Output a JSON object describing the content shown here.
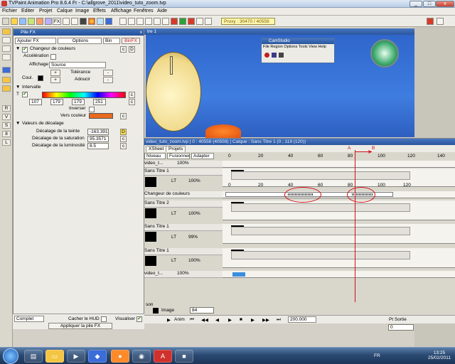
{
  "window": {
    "title": "TVPaint Animation Pro 8.6.4 Fr - C:\\allgrove_2011\\video_tuto_zoom.tvp",
    "controls": {
      "min": "_",
      "max": "□",
      "close": "x"
    }
  },
  "menu": [
    "Fichier",
    "Editer",
    "Projet",
    "Calque",
    "Image",
    "Effets",
    "Affichage",
    "Fenêtres",
    "Aide"
  ],
  "toolbar": {
    "fx_label": "FX",
    "proxy": "Proxy : 30470 / 40559"
  },
  "left_tools": [
    "R",
    "V",
    "S",
    "8",
    "L"
  ],
  "pile_fx": {
    "title": "Pile FX",
    "close": "x",
    "header_buttons": {
      "add": "Ajouter FX",
      "options": "Options",
      "bin": "Bin",
      "binfx": "BinFX"
    },
    "effect_name": "Changeur de couleurs",
    "acceleration_label": "Accélération",
    "affichage_label": "Affichage",
    "affichage_value": "Source",
    "tolerance_label": "Tolérance",
    "adoucir_label": "Adoucir",
    "coul_label": "Coul.",
    "plus": "+",
    "minus": "-",
    "intervalle_label": "Intervalle",
    "t_label": "T",
    "range_values": [
      "107",
      "179",
      "179",
      "251"
    ],
    "inverser_label": "Inverser",
    "vers_couleur_label": "Vers couleur",
    "vers_couleur_color": "#e86a1e",
    "decalage_title": "Valeurs de décalage",
    "decalage": [
      {
        "label": "Décalage de la teinte",
        "value": "-163.391"
      },
      {
        "label": "Décalage de la saturation",
        "value": "95.3571"
      },
      {
        "label": "Décalage de la luminosité",
        "value": "8.5"
      }
    ],
    "c_btn": "c",
    "d_btn": "D",
    "complet": "Complet",
    "cacher_hud": "Cacher le HUD",
    "visualiser": "Visualiser",
    "appliquer": "Appliquer la pile FX"
  },
  "viewer": {
    "title": "tre 1",
    "camstudio": {
      "title": "CamStudio",
      "menu": [
        "File",
        "Region",
        "Options",
        "Tools",
        "View",
        "Help"
      ]
    }
  },
  "xsheet": {
    "info": "video_tuto_zoom.tvp | 0 : 40558 (40559)   |  Calque : Sans Titre 1 (0 , 119 (120))",
    "tabs": [
      "XSheet",
      "Projets"
    ],
    "header": {
      "mode": "Niveau",
      "blend": "Fusionner",
      "adapt": "Adapter"
    },
    "ruler_top": [
      "0",
      "20",
      "40",
      "60",
      "80",
      "100",
      "120",
      "140"
    ],
    "layers": [
      {
        "name": "video_t...",
        "opacity": "100%"
      },
      {
        "name": "Sans Titre 1",
        "opacity": "100%"
      },
      {
        "name": "Changeur de couleurs",
        "opacity": ""
      },
      {
        "name": "Sans Titre 2",
        "opacity": "100%"
      },
      {
        "name": "Sans Titre 1",
        "opacity": "99%"
      },
      {
        "name": "Sans Titre 1",
        "opacity": "100%"
      },
      {
        "name": "video_t...",
        "opacity": "100%"
      }
    ],
    "lt_label": "LT",
    "marker_a": "A",
    "marker_b": "B",
    "ruler_track": [
      "0",
      "20",
      "40",
      "60",
      "80",
      "100",
      "120"
    ],
    "son_label": "son",
    "image_label": "Image",
    "image_value": "84"
  },
  "playbar": {
    "anim_label": "Anim",
    "fps_value": "200.000",
    "pt_sortie": "Pt Sortie",
    "pt_value": "0"
  },
  "taskbar": {
    "lang": "FR",
    "time": "13:25",
    "date": "25/02/2011"
  },
  "colors": {
    "accent_red": "#d01010",
    "title_blue": "#245099",
    "canvas_blue": "#3f7de0"
  }
}
